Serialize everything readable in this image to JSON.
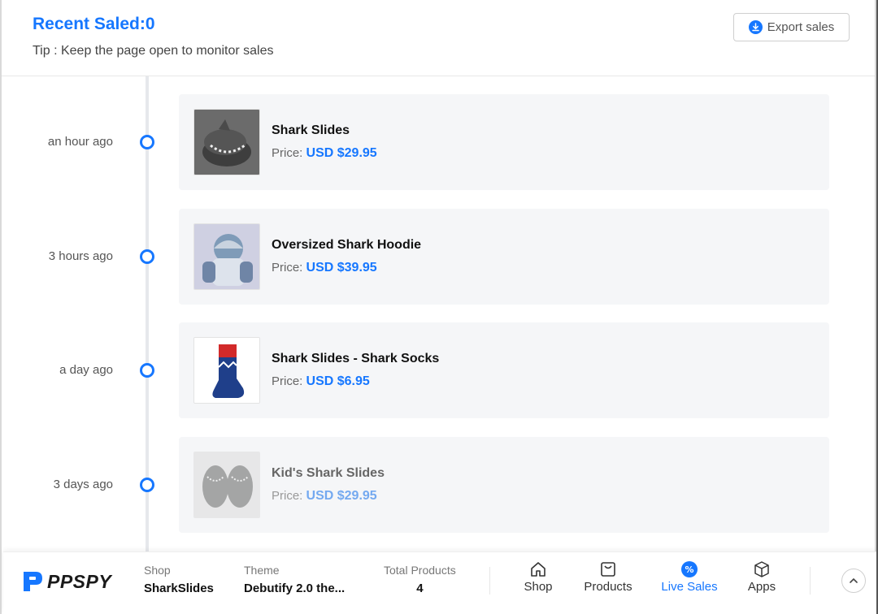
{
  "header": {
    "title": "Recent Saled:0",
    "tip": "Tip : Keep the page open to monitor sales",
    "export_label": "Export sales"
  },
  "sales": [
    {
      "time": "an hour ago",
      "name": "Shark Slides",
      "price_label": "Price:",
      "price": "USD $29.95"
    },
    {
      "time": "3 hours ago",
      "name": "Oversized Shark Hoodie",
      "price_label": "Price:",
      "price": "USD $39.95"
    },
    {
      "time": "a day ago",
      "name": "Shark Slides - Shark Socks",
      "price_label": "Price:",
      "price": "USD $6.95"
    },
    {
      "time": "3 days ago",
      "name": "Kid's Shark Slides",
      "price_label": "Price:",
      "price": "USD $29.95"
    }
  ],
  "footer": {
    "logo": "PPSPY",
    "shop_label": "Shop",
    "shop_value": "SharkSlides",
    "theme_label": "Theme",
    "theme_value": "Debutify 2.0 the...",
    "products_label": "Total Products",
    "products_value": "4",
    "nav": [
      {
        "label": "Shop",
        "icon": "home-icon",
        "active": false
      },
      {
        "label": "Products",
        "icon": "bag-icon",
        "active": false
      },
      {
        "label": "Live Sales",
        "icon": "percent-icon",
        "active": true
      },
      {
        "label": "Apps",
        "icon": "cube-icon",
        "active": false
      }
    ]
  },
  "colors": {
    "accent": "#1677ff",
    "card_bg": "#f5f6f8",
    "timeline": "#e6e8ec"
  }
}
